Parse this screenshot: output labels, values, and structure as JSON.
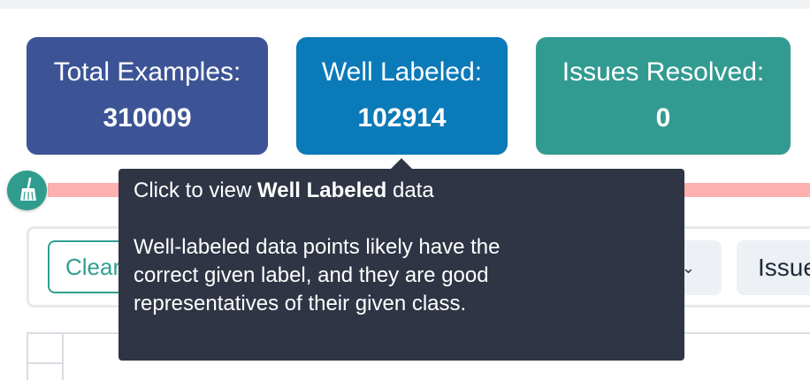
{
  "stats": {
    "total": {
      "label": "Total Examples:",
      "value": "310009"
    },
    "well_labeled": {
      "label": "Well Labeled:",
      "value": "102914"
    },
    "issues_resolved": {
      "label": "Issues Resolved:",
      "value": "0"
    }
  },
  "toolbar": {
    "clear_label": "Clear",
    "dropdown_chevron": "⌄",
    "issues_label": "Issues"
  },
  "tooltip": {
    "line1_prefix": "Click to view ",
    "line1_bold": "Well Labeled",
    "line1_suffix": " data",
    "body_line1": "Well-labeled data points likely have the",
    "body_line2": "correct given label, and they are good",
    "body_line3": "representatives of their given class."
  },
  "icons": {
    "broom": "broom-icon",
    "chevron": "chevron-down-icon"
  },
  "colors": {
    "total_card": "#3c5496",
    "well_card": "#0b7ab9",
    "resolved_card": "#329b91",
    "progress_track": "#fdb0b0",
    "tooltip_bg": "#2f3544",
    "accent": "#319f91"
  }
}
